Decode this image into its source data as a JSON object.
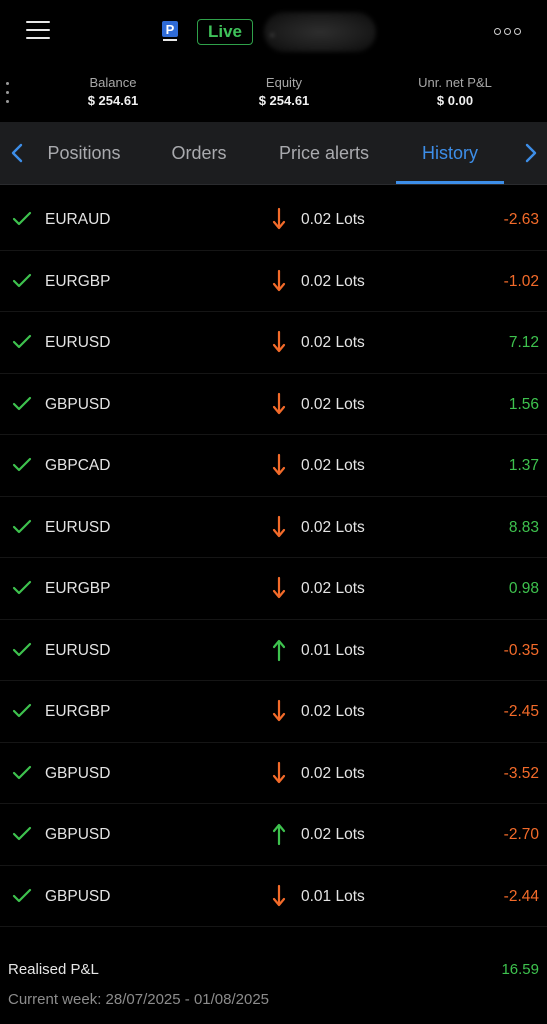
{
  "header": {
    "live_label": "Live",
    "account_name": ".",
    "menu_icon": "hamburger-menu-icon",
    "more_icon": "more-dots-icon",
    "logo_letter": "P"
  },
  "summary": {
    "balance_label": "Balance",
    "balance_value": "$ 254.61",
    "equity_label": "Equity",
    "equity_value": "$ 254.61",
    "unr_label": "Unr. net P&L",
    "unr_value": "$ 0.00"
  },
  "tabs": {
    "items": [
      "Positions",
      "Orders",
      "Price alerts",
      "History"
    ],
    "active": "History"
  },
  "history": [
    {
      "symbol": "EURAUD",
      "direction": "down",
      "lots": "0.02 Lots",
      "pnl": "-2.63"
    },
    {
      "symbol": "EURGBP",
      "direction": "down",
      "lots": "0.02 Lots",
      "pnl": "-1.02"
    },
    {
      "symbol": "EURUSD",
      "direction": "down",
      "lots": "0.02 Lots",
      "pnl": "7.12"
    },
    {
      "symbol": "GBPUSD",
      "direction": "down",
      "lots": "0.02 Lots",
      "pnl": "1.56"
    },
    {
      "symbol": "GBPCAD",
      "direction": "down",
      "lots": "0.02 Lots",
      "pnl": "1.37"
    },
    {
      "symbol": "EURUSD",
      "direction": "down",
      "lots": "0.02 Lots",
      "pnl": "8.83"
    },
    {
      "symbol": "EURGBP",
      "direction": "down",
      "lots": "0.02 Lots",
      "pnl": "0.98"
    },
    {
      "symbol": "EURUSD",
      "direction": "up",
      "lots": "0.01 Lots",
      "pnl": "-0.35"
    },
    {
      "symbol": "EURGBP",
      "direction": "down",
      "lots": "0.02 Lots",
      "pnl": "-2.45"
    },
    {
      "symbol": "GBPUSD",
      "direction": "down",
      "lots": "0.02 Lots",
      "pnl": "-3.52"
    },
    {
      "symbol": "GBPUSD",
      "direction": "up",
      "lots": "0.02 Lots",
      "pnl": "-2.70"
    },
    {
      "symbol": "GBPUSD",
      "direction": "down",
      "lots": "0.01 Lots",
      "pnl": "-2.44"
    }
  ],
  "footer": {
    "realised_label": "Realised P&L",
    "realised_value": "16.59",
    "week_label": "Current week: 28/07/2025 - 01/08/2025"
  },
  "colors": {
    "positive": "#3ec24e",
    "negative": "#f36b2a",
    "accent": "#3d8ee8",
    "live": "#3fc25a",
    "check": "#3ec24e",
    "sell_arrow": "#f36b2a",
    "buy_arrow": "#3ec24e"
  }
}
